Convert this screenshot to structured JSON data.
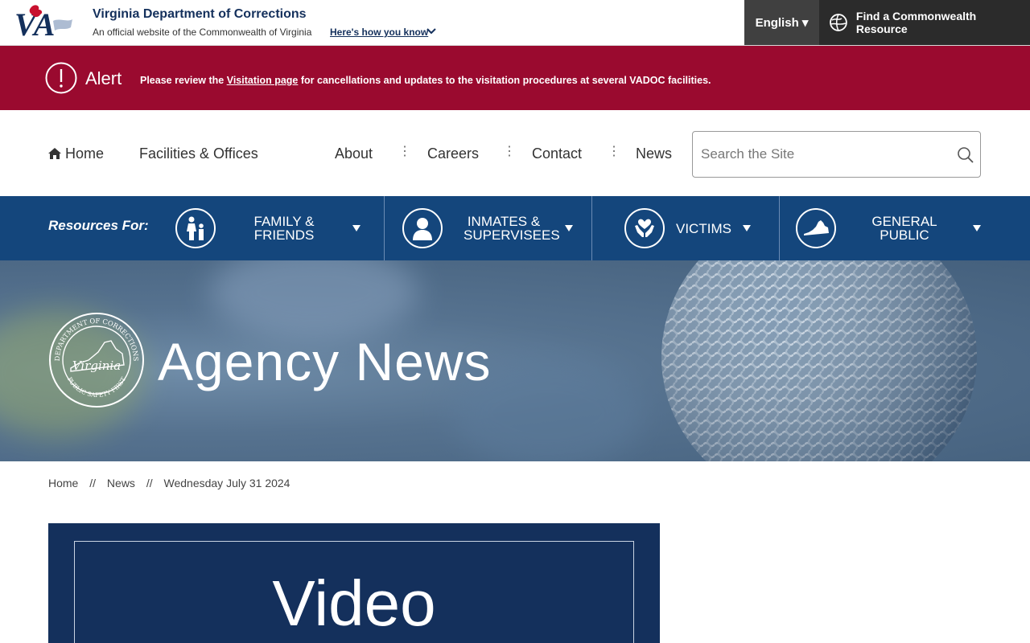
{
  "header": {
    "org_name": "Virginia Department of Corrections",
    "official_text": "An official website of the Commonwealth of Virginia",
    "how_know": "Here's how you know",
    "language": "English ▾",
    "find_resource": "Find a Commonwealth Resource",
    "logo_text": "VA"
  },
  "alert": {
    "title": "Alert",
    "text_before": "Please review the ",
    "link": "Visitation page",
    "text_after": " for cancellations and updates to the visitation procedures at several VADOC facilities."
  },
  "nav": {
    "home": "Home",
    "facilities": "Facilities & Offices",
    "about": "About",
    "careers": "Careers",
    "contact": "Contact",
    "news": "News",
    "search_placeholder": "Search the Site"
  },
  "resources": {
    "label": "Resources For:",
    "items": [
      {
        "label": "Family & Friends",
        "icon": "family-icon"
      },
      {
        "label": "Inmates & Supervisees",
        "icon": "person-icon"
      },
      {
        "label": "Victims",
        "icon": "heart-hands-icon"
      },
      {
        "label": "General Public",
        "icon": "virginia-map-icon"
      }
    ]
  },
  "hero": {
    "title": "Agency News",
    "seal_top": "DEPARTMENT OF CORRECTIONS",
    "seal_mid": "Virginia",
    "seal_bottom": "PUBLIC SAFETY FIRST"
  },
  "breadcrumb": {
    "home": "Home",
    "sep": "//",
    "news": "News",
    "current": "Wednesday July 31 2024"
  },
  "card": {
    "text": "Video"
  },
  "colors": {
    "navy": "#14305c",
    "alert": "#9a0a2f",
    "resources_bar": "#14467c"
  }
}
